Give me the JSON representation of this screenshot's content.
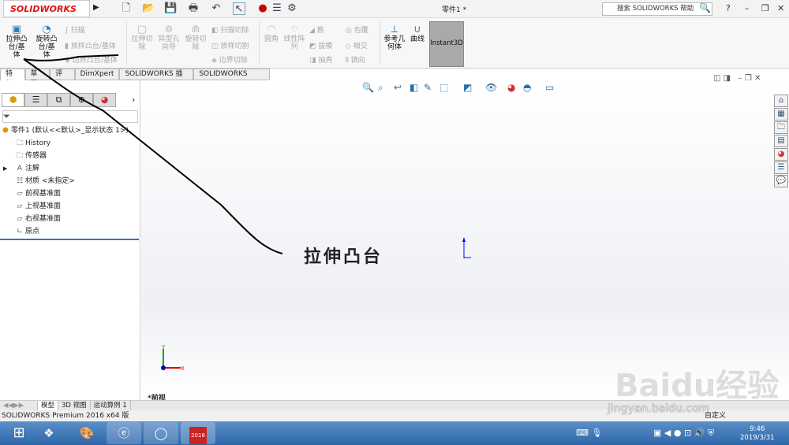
{
  "app": {
    "logo": "SOLIDWORKS",
    "doc_title": "零件1 *",
    "help_search": "搜索 SOLIDWORKS 帮助"
  },
  "ribbon": {
    "extrude_boss": "拉伸凸台/基体",
    "revolve_boss": "旋转凸台/基体",
    "sweep": "扫描",
    "loft": "放样凸台/基体",
    "boundary": "边界凸台/基体",
    "extrude_cut": "拉伸切除",
    "hole_wizard": "异型孔向导",
    "revolve_cut": "旋转切除",
    "sweep_cut": "扫描切除",
    "loft_cut": "放样切割",
    "boundary_cut": "边界切除",
    "fillet": "圆角",
    "linear_pattern": "线性阵列",
    "rib": "筋",
    "draft": "拔模",
    "shell": "抽壳",
    "wrap": "包覆",
    "intersect": "相交",
    "mirror": "镜向",
    "ref_geometry": "参考几何体",
    "curves": "曲线",
    "instant3d": "Instant3D"
  },
  "tabs": [
    "特征",
    "草图",
    "评估",
    "DimXpert",
    "SOLIDWORKS 插件",
    "SOLIDWORKS MBD"
  ],
  "tree": {
    "root": "零件1 (默认<<默认>_显示状态 1>)",
    "items": [
      "History",
      "传感器",
      "注解",
      "材质 <未指定>",
      "前视基准面",
      "上视基准面",
      "右视基准面",
      "原点"
    ]
  },
  "graphics": {
    "view_label": "*前视"
  },
  "bottom_tabs": [
    "模型",
    "3D 视图",
    "运动算例 1"
  ],
  "status": {
    "left": "SOLIDWORKS Premium 2016 x64 版",
    "right": "自定义"
  },
  "taskbar": {
    "time": "9:46",
    "date": "2019/3/31",
    "sw_label": "2016"
  },
  "annotation": {
    "text": "拉伸凸台"
  },
  "watermark": {
    "text": "Baidu经验",
    "url": "jingyan.baidu.com"
  }
}
